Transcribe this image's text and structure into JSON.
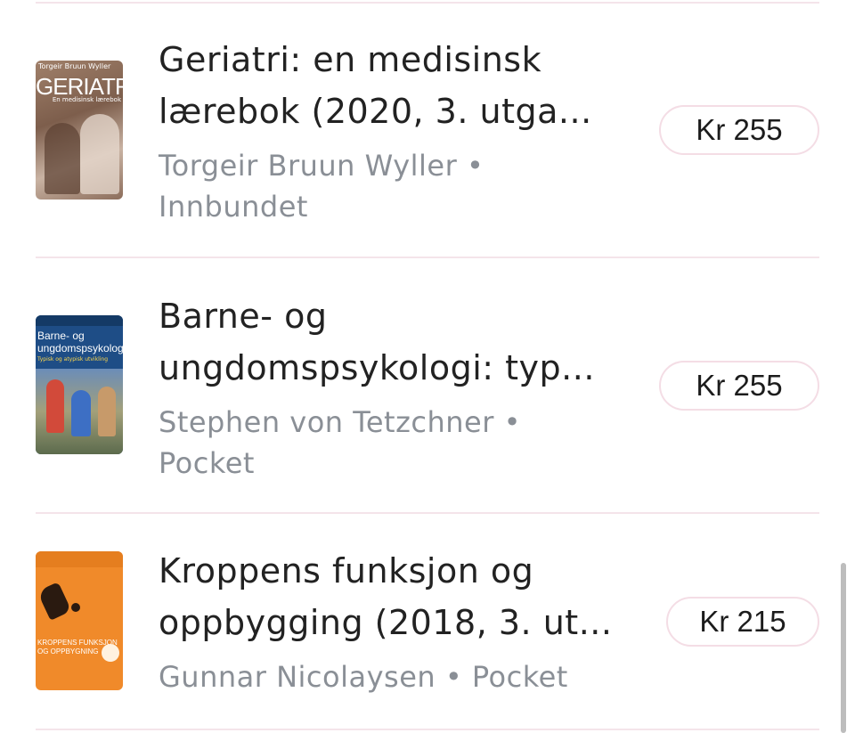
{
  "books": [
    {
      "title_line1": "Geriatri: en medisinsk",
      "title_line2": "lærebok (2020, 3. utga...",
      "meta_line1": "Torgeir Bruun Wyller •",
      "meta_line2": "Innbundet",
      "price": "Kr 255",
      "cover": {
        "header": "Torgeir Bruun Wyller",
        "title": "GERIATRI",
        "subtitle": "En medisinsk lærebok"
      }
    },
    {
      "title_line1": "Barne- og",
      "title_line2": "ungdomspsykologi: typ...",
      "meta_line1": "Stephen von Tetzchner •",
      "meta_line2": "Pocket",
      "price": "Kr 255",
      "cover": {
        "title_line1": "Barne- og",
        "title_line2": "ungdomspsykologi",
        "subtitle": "Typisk og atypisk utvikling"
      }
    },
    {
      "title_line1": "Kroppens funksjon og",
      "title_line2": "oppbygging (2018, 3. ut...",
      "meta_line1": "Gunnar Nicolaysen • Pocket",
      "meta_line2": "",
      "price": "Kr 215",
      "cover": {
        "title_line1": "KROPPENS FUNKSJON",
        "title_line2": "OG OPPBYGNING"
      }
    }
  ]
}
